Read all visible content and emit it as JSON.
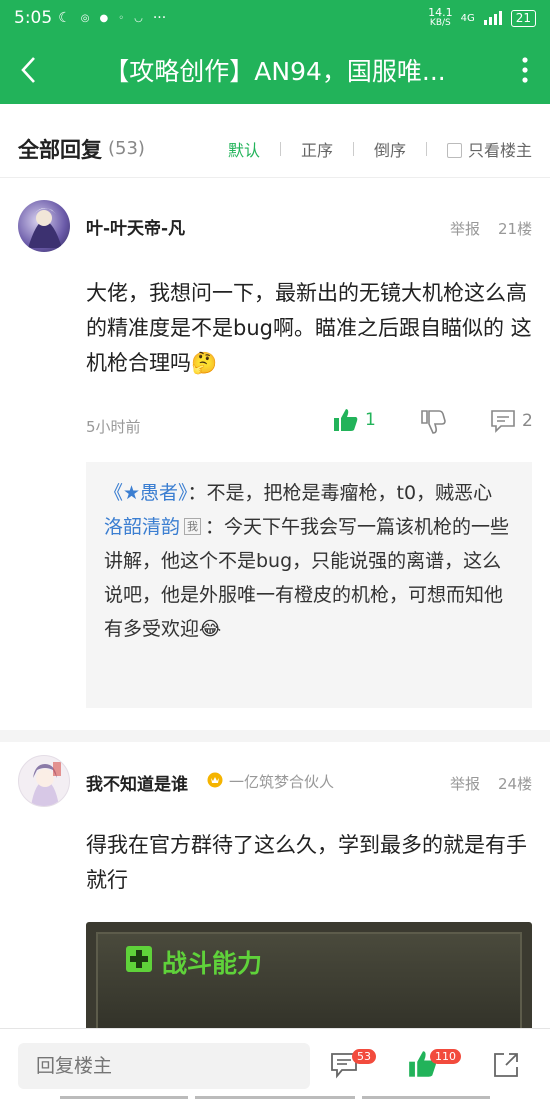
{
  "status": {
    "time": "5:05",
    "speed_value": "14.1",
    "speed_unit": "KB/S",
    "net": "4G",
    "battery": "21"
  },
  "appbar": {
    "title": "【攻略创作】AN94，国服唯..."
  },
  "filter": {
    "header": "全部回复",
    "count": "(53)",
    "sort_default": "默认",
    "sort_asc": "正序",
    "sort_desc": "倒序",
    "only_op": "只看楼主"
  },
  "comments": [
    {
      "username": "叶-叶天帝-凡",
      "report": "举报",
      "floor": "21楼",
      "text": "大佬，我想问一下，最新出的无镜大机枪这么高的精准度是不是bug啊。瞄准之后跟自瞄似的 这机枪合理吗🤔",
      "time": "5小时前",
      "likes": "1",
      "comments": "2",
      "replies": [
        {
          "name": "《★愚者》",
          "text": "：不是，把枪是毒瘤枪，t0，贼恶心"
        },
        {
          "name": "洛韶清韵",
          "tag": "我",
          "text": "：今天下午我会写一篇该机枪的一些讲解，他这个不是bug，只能说强的离谱，这么说吧，他是外服唯一有橙皮的机枪，可想而知他有多受欢迎😂"
        }
      ]
    },
    {
      "username": "我不知道是谁",
      "badge": "一亿筑梦合伙人",
      "report": "举报",
      "floor": "24楼",
      "text": "得我在官方群待了这么久，学到最多的就是有手就行",
      "image_caption": "战斗能力"
    }
  ],
  "bottom": {
    "reply_placeholder": "回复楼主",
    "comment_count": "53",
    "like_count": "110"
  },
  "colors": {
    "brand": "#22b35a",
    "link": "#3b7ed1",
    "badge": "#f24b3d"
  }
}
